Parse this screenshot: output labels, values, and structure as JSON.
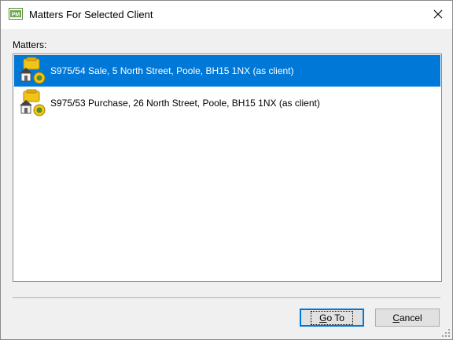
{
  "window": {
    "title": "Matters For Selected Client"
  },
  "icons": {
    "app": "pm-app-icon",
    "close": "close-icon",
    "matter": "matter-property-icon"
  },
  "colors": {
    "selection": "#0078d7",
    "default_button_border": "#0078d7"
  },
  "matters": {
    "label": "Matters:",
    "items": [
      {
        "text": "S975/54 Sale, 5 North Street, Poole, BH15 1NX (as client)",
        "selected": true
      },
      {
        "text": "S975/53 Purchase, 26 North Street, Poole, BH15 1NX (as client)",
        "selected": false
      }
    ]
  },
  "buttons": {
    "goto": {
      "accel": "G",
      "rest": "o To"
    },
    "cancel": {
      "accel": "C",
      "rest": "ancel"
    }
  }
}
